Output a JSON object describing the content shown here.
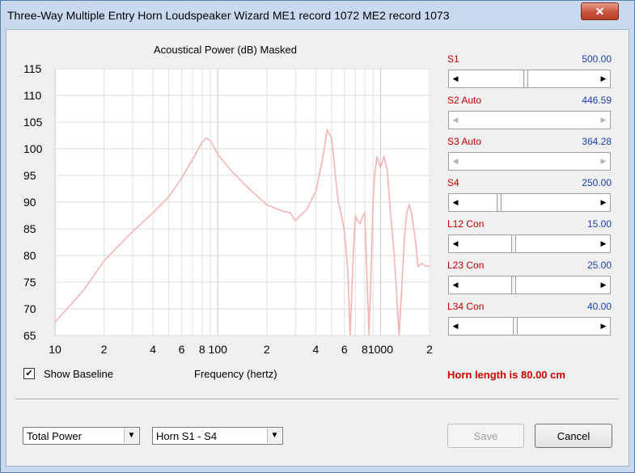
{
  "window": {
    "title": "Three-Way Multiple Entry Horn Loudspeaker Wizard   ME1 record 1072   ME2 record 1073",
    "close_label": "✕"
  },
  "chart": {
    "title": "Acoustical Power (dB)   Masked"
  },
  "sliders": [
    {
      "label": "S1",
      "value": "500.00",
      "position": 0.47,
      "enabled": true
    },
    {
      "label": "S2 Auto",
      "value": "446.59",
      "position": 0.0,
      "enabled": false
    },
    {
      "label": "S3 Auto",
      "value": "364.28",
      "position": 0.0,
      "enabled": false
    },
    {
      "label": "S4",
      "value": "250.00",
      "position": 0.27,
      "enabled": true
    },
    {
      "label": "L12 Con",
      "value": "15.00",
      "position": 0.38,
      "enabled": true
    },
    {
      "label": "L23 Con",
      "value": "25.00",
      "position": 0.38,
      "enabled": true
    },
    {
      "label": "L34 Con",
      "value": "40.00",
      "position": 0.39,
      "enabled": true
    }
  ],
  "show_baseline": {
    "label": "Show Baseline",
    "checked": true
  },
  "frequency_label": "Frequency (hertz)",
  "horn_length": "Horn length is 80.00 cm",
  "combos": {
    "power": {
      "value": "Total Power"
    },
    "horn": {
      "value": "Horn S1 - S4"
    }
  },
  "buttons": {
    "save": "Save",
    "cancel": "Cancel"
  },
  "colors": {
    "curve": "#f4b4b4",
    "label_red": "#c00000",
    "value_blue": "#1a3fb0"
  },
  "chart_data": {
    "type": "line",
    "title": "Acoustical Power (dB)   Masked",
    "xlabel": "Frequency (hertz)",
    "ylabel": "",
    "xscale": "log",
    "xlim": [
      10,
      2000
    ],
    "ylim": [
      65,
      115
    ],
    "y_ticks": [
      "115",
      "110",
      "105",
      "100",
      "95",
      "90",
      "85",
      "80",
      "75",
      "70",
      "65"
    ],
    "x_ticks": [
      {
        "v": 10,
        "t": "10"
      },
      {
        "v": 20,
        "t": "2"
      },
      {
        "v": 40,
        "t": "4"
      },
      {
        "v": 60,
        "t": "6"
      },
      {
        "v": 80,
        "t": "8"
      },
      {
        "v": 100,
        "t": "100"
      },
      {
        "v": 200,
        "t": "2"
      },
      {
        "v": 400,
        "t": "4"
      },
      {
        "v": 600,
        "t": "6"
      },
      {
        "v": 800,
        "t": "8"
      },
      {
        "v": 1000,
        "t": "1000"
      },
      {
        "v": 2000,
        "t": "2"
      }
    ],
    "grid": true,
    "series": [
      {
        "x": [
          10,
          15,
          20,
          30,
          40,
          50,
          60,
          70,
          80,
          85,
          90,
          100,
          120,
          150,
          200,
          250,
          280,
          300,
          320,
          350,
          400,
          440,
          470,
          500,
          520,
          550,
          580,
          600,
          630,
          650,
          680,
          700,
          720,
          750,
          780,
          800,
          850,
          880,
          900,
          920,
          950,
          1000,
          1050,
          1100,
          1150,
          1200,
          1250,
          1300,
          1350,
          1400,
          1450,
          1500,
          1550,
          1600,
          1650,
          1700,
          1800,
          1900,
          2000
        ],
        "y": [
          67.5,
          73.5,
          79.0,
          84.5,
          88.0,
          91.0,
          94.5,
          98.0,
          101.2,
          102.0,
          101.5,
          99.0,
          96.0,
          93.0,
          89.5,
          88.3,
          88.0,
          86.5,
          87.5,
          88.5,
          92.0,
          98.0,
          103.5,
          102.0,
          97.0,
          90.0,
          87.0,
          84.5,
          77.0,
          65.0,
          80.0,
          87.5,
          86.5,
          86.0,
          87.5,
          88.0,
          65.0,
          80.0,
          90.0,
          95.0,
          98.5,
          96.5,
          98.5,
          96.0,
          88.0,
          82.0,
          74.0,
          65.0,
          74.0,
          83.0,
          88.0,
          89.5,
          88.0,
          85.0,
          82.0,
          78.0,
          78.5,
          78.0,
          78.0
        ]
      }
    ]
  }
}
